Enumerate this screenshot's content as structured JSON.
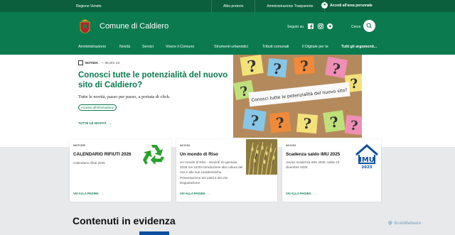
{
  "topbar": {
    "region": "Regione Veneto",
    "links": [
      "Albo pretorio",
      "Amministrazione Trasparente"
    ],
    "login_label": "Accedi all'area personale"
  },
  "header": {
    "title": "Comune di Caldiero",
    "social_label": "Seguici su",
    "search_label": "Cerca"
  },
  "nav": {
    "items": [
      "Amministrazione",
      "Novità",
      "Servizi",
      "Vivere il Comune",
      "Strumenti urbanistici",
      "Tributi comunali",
      "Il Digitale per te",
      "Tutti gli argomenti..."
    ]
  },
  "hero": {
    "badge": "NOTIZIA",
    "date": "— 05 DIC 23",
    "title": "Conosci tutte le potenzialità del nuovo sito di Caldiero?",
    "subtitle": "Tutte le novità, passo per passo, a portata di click.",
    "chip": "Accesso all'informazione",
    "all_news": "TUTTE LE NOVITÀ",
    "image_note_text": "Conosci tutte le potenzialità del nuovo sito?"
  },
  "cards": [
    {
      "category": "NOTIZIE",
      "title": "CALENDARIO RIFIUTI 2026",
      "text": "Calendario rifiuti 2026",
      "more": "VAI ALLA PAGINA"
    },
    {
      "category": "AVVISI",
      "title": "Un mondo di Riso",
      "text": "Un mondo di Riso - Venerdì 23 gennaio 2026 ore 18:00 Introduzione alla cultura del riso e alle sue caratteristiche. Presentazione dei piatti e dei vini Degustazione",
      "more": "VAI ALLA PAGINA"
    },
    {
      "category": "AVVISI",
      "title": "Scadenza saldo IMU 2025",
      "text": "Avviso scadenza IMU 2025: saldo 16 dicembre 2025",
      "more": "VAI ALLA PAGINA"
    }
  ],
  "imu_logo": {
    "label": "IMU",
    "year": "2025"
  },
  "featured": {
    "title": "Contenuti in evidenza"
  },
  "watermark": "ScanMalware",
  "colors": {
    "primary": "#0b7a4f",
    "topbar": "#0b5f3c",
    "imu_blue": "#0b4fa0",
    "recycle": "#2aa12a"
  }
}
